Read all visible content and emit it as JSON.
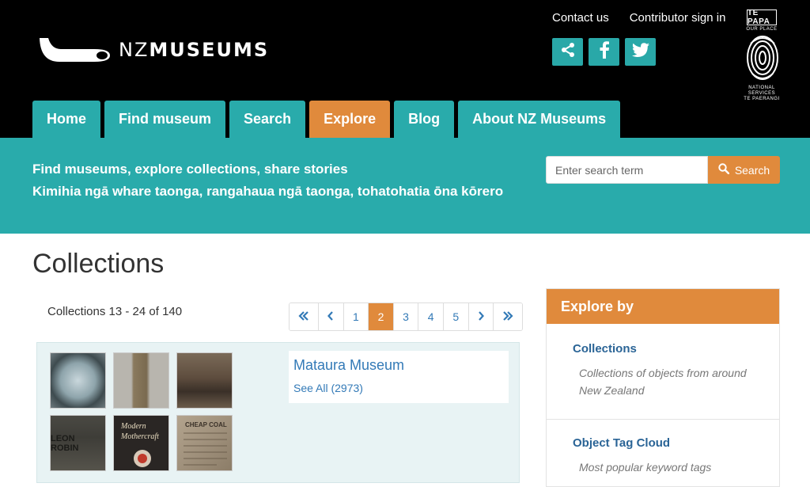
{
  "brand": {
    "name_prefix": "NZ",
    "name_main": "MUSEUMS"
  },
  "toplinks": {
    "contact": "Contact us",
    "signin": "Contributor sign in"
  },
  "social": [
    {
      "icon": "share-icon"
    },
    {
      "icon": "facebook-icon"
    },
    {
      "icon": "twitter-icon"
    }
  ],
  "partner_logo": {
    "top": "TE PAPA",
    "mid": "OUR PLACE",
    "bottom1": "NATIONAL",
    "bottom2": "SERVICES",
    "bottom3": "TE PAERANGI"
  },
  "nav": {
    "tabs": [
      {
        "label": "Home"
      },
      {
        "label": "Find museum"
      },
      {
        "label": "Search"
      },
      {
        "label": "Explore",
        "active": true
      },
      {
        "label": "Blog"
      },
      {
        "label": "About NZ Museums"
      }
    ]
  },
  "banner": {
    "line1": "Find museums, explore collections, share stories",
    "line2": "Kimihia ngā whare taonga, rangahaua ngā taonga, tohatohatia ōna kōrero"
  },
  "search": {
    "placeholder": "Enter search term",
    "button_label": "Search"
  },
  "main": {
    "title": "Collections",
    "count": "Collections 13 - 24 of 140",
    "pager": {
      "items": [
        "«",
        "‹",
        "1",
        "2",
        "3",
        "4",
        "5",
        "›",
        "»"
      ],
      "active": "2"
    }
  },
  "card": {
    "title": "Mataura Museum",
    "link": "See All (2973)",
    "thumbs": [
      {
        "name": "paperweight-thumb",
        "color": "#5a6b70"
      },
      {
        "name": "coat-thumb",
        "color": "#8a7a5e"
      },
      {
        "name": "group-photo-thumb",
        "color": "#5e4d3e"
      },
      {
        "name": "leon-robin-thumb",
        "color": "#3e3d38"
      },
      {
        "name": "modern-mothercraft-thumb",
        "color": "#2a2624"
      },
      {
        "name": "cheap-coal-thumb",
        "color": "#a0917c"
      }
    ]
  },
  "sidebar": {
    "heading": "Explore by",
    "items": [
      {
        "title": "Collections",
        "desc": "Collections of objects from around New Zealand"
      },
      {
        "title": "Object Tag Cloud",
        "desc": "Most popular keyword tags"
      }
    ]
  },
  "colors": {
    "teal": "#29abab",
    "orange": "#e08a3c",
    "link": "#337ab7",
    "header": "#000000"
  }
}
